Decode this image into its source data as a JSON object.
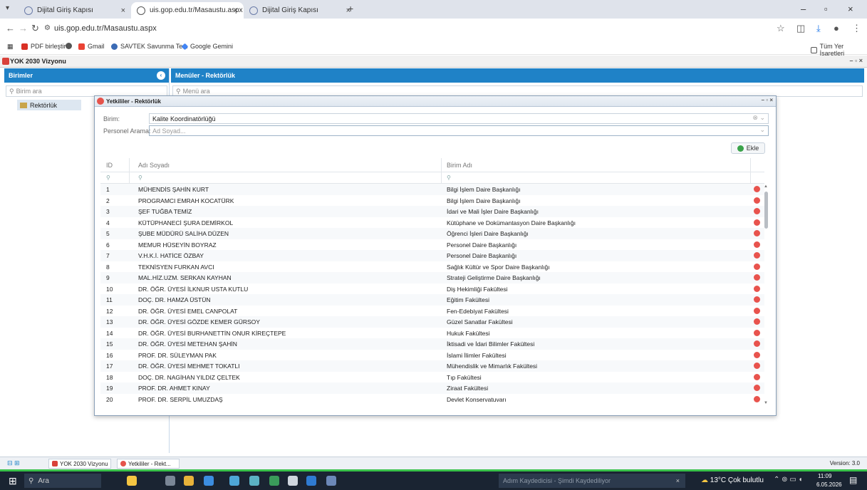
{
  "browser": {
    "tabs": [
      {
        "title": "Dijital Giriş Kapısı",
        "active": false
      },
      {
        "title": "uis.gop.edu.tr/Masaustu.aspx",
        "active": true
      },
      {
        "title": "Dijital Giriş Kapısı",
        "active": false
      }
    ],
    "url": "uis.gop.edu.tr/Masaustu.aspx",
    "bookmarks": [
      "PDF birleştir",
      "Gmail",
      "SAVTEK Savunma Te...",
      "Google Gemini"
    ],
    "all_bookmarks": "Tüm Yer İşaretleri"
  },
  "app": {
    "title": "YOK 2030 Vizyonu",
    "left_header": "Birimler",
    "left_search_placeholder": "Birim ara",
    "tree_item": "Rektörlük",
    "right_header": "Menüler - Rektörlük",
    "right_search_placeholder": "Menü ara",
    "version": "Version: 3.0"
  },
  "modal": {
    "title": "Yetkililer - Rektörlük",
    "birim_label": "Birim:",
    "birim_value": "Kalite Koordinatörlüğü",
    "personel_label": "Personel Arama:",
    "personel_placeholder": "Ad Soyad...",
    "add_button": "Ekle",
    "columns": [
      "ID",
      "Adı Soyadı",
      "Birim Adı"
    ],
    "rows": [
      [
        "1",
        "MÜHENDİS ŞAHİN KURT",
        "Bilgi İşlem Daire Başkanlığı"
      ],
      [
        "2",
        "PROGRAMCI EMRAH KOCATÜRK",
        "Bilgi İşlem Daire Başkanlığı"
      ],
      [
        "3",
        "ŞEF TUĞBA TEMİZ",
        "İdari ve Mali İşler Daire Başkanlığı"
      ],
      [
        "4",
        "KÜTÜPHANECİ ŞURA DEMİRKOL",
        "Kütüphane ve Dokümantasyon Daire Başkanlığı"
      ],
      [
        "5",
        "ŞUBE MÜDÜRÜ SALİHA DÜZEN",
        "Öğrenci İşleri Daire Başkanlığı"
      ],
      [
        "6",
        "MEMUR HÜSEYİN BOYRAZ",
        "Personel Daire Başkanlığı"
      ],
      [
        "7",
        "V.H.K.İ. HATİCE ÖZBAY",
        "Personel Daire Başkanlığı"
      ],
      [
        "8",
        "TEKNİSYEN FURKAN AVCI",
        "Sağlık Kültür ve Spor Daire Başkanlığı"
      ],
      [
        "9",
        "MAL.HİZ.UZM. SERKAN KAYHAN",
        "Strateji Geliştirme Daire Başkanlığı"
      ],
      [
        "10",
        "DR. ÖĞR. ÜYESİ İLKNUR USTA KUTLU",
        "Diş Hekimliği Fakültesi"
      ],
      [
        "11",
        "DOÇ. DR. HAMZA ÜSTÜN",
        "Eğitim Fakültesi"
      ],
      [
        "12",
        "DR. ÖĞR. ÜYESİ EMEL CANPOLAT",
        "Fen-Edebiyat Fakültesi"
      ],
      [
        "13",
        "DR. ÖĞR. ÜYESİ GÖZDE KEMER GÜRSOY",
        "Güzel Sanatlar Fakültesi"
      ],
      [
        "14",
        "DR. ÖĞR. ÜYESİ BURHANETTİN ONUR KİREÇTEPE",
        "Hukuk Fakültesi"
      ],
      [
        "15",
        "DR. ÖĞR. ÜYESİ METEHAN ŞAHİN",
        "İktisadi ve İdari Bilimler Fakültesi"
      ],
      [
        "16",
        "PROF. DR. SÜLEYMAN PAK",
        "İslami İlimler Fakültesi"
      ],
      [
        "17",
        "DR. ÖĞR. ÜYESİ MEHMET TOKATLI",
        "Mühendislik ve Mimarlık Fakültesi"
      ],
      [
        "18",
        "DOÇ. DR. NAGİHAN YILDIZ ÇELTEK",
        "Tıp Fakültesi"
      ],
      [
        "19",
        "PROF. DR. AHMET KINAY",
        "Ziraat Fakültesi"
      ],
      [
        "20",
        "PROF. DR. SERPİL UMUZDAŞ",
        "Devlet Konservatuvarı"
      ]
    ]
  },
  "taskbar": {
    "app_tabs": [
      "YOK 2030 Vizyonu",
      "Yetkililer - Rekt..."
    ],
    "search": "Ara",
    "notification": "Adım Kaydedicisi - Şimdi Kaydediliyor",
    "weather": "13°C Çok bulutlu",
    "time": "11:09",
    "date": "6.05.2026"
  },
  "colors": {
    "accent": "#1f82c7",
    "delete": "#e8534d",
    "add": "#3aa34a",
    "taskbar_line": "#39c24a"
  }
}
